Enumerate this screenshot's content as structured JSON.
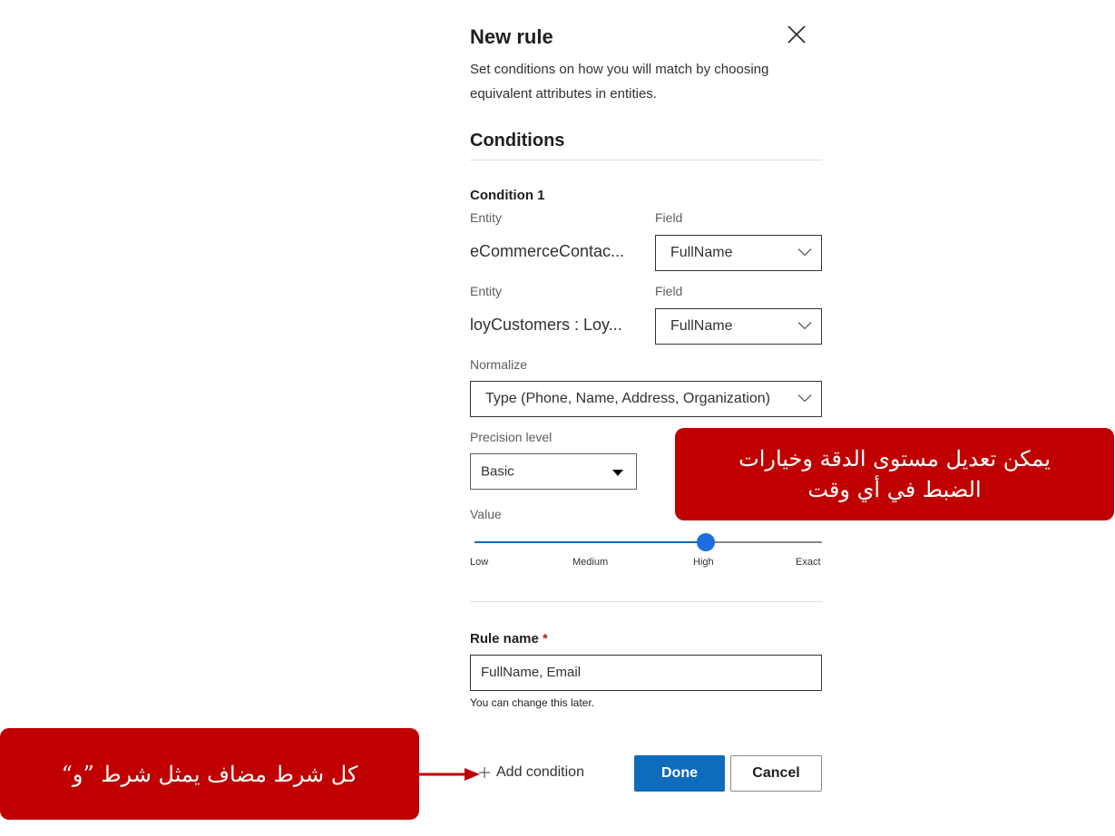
{
  "panel": {
    "title": "New rule",
    "description": "Set conditions on how you will match by choosing equivalent attributes in entities.",
    "conditions_heading": "Conditions"
  },
  "condition": {
    "title": "Condition 1",
    "row1": {
      "entity_label": "Entity",
      "field_label": "Field",
      "entity_value": "eCommerceContac...",
      "field_value": "FullName"
    },
    "row2": {
      "entity_label": "Entity",
      "field_label": "Field",
      "entity_value": "loyCustomers : Loy...",
      "field_value": "FullName"
    },
    "normalize_label": "Normalize",
    "normalize_value": "Type (Phone, Name, Address, Organization)",
    "precision_label": "Precision level",
    "precision_value": "Basic",
    "value_label": "Value",
    "slider": {
      "ticks": [
        "Low",
        "Medium",
        "High",
        "Exact"
      ],
      "selected": "High",
      "level": 0.667
    }
  },
  "rule_name": {
    "label": "Rule name",
    "required_mark": "*",
    "value": "FullName, Email",
    "hint": "You can change this later."
  },
  "actions": {
    "add_condition": "Add condition",
    "done": "Done",
    "cancel": "Cancel"
  },
  "callouts": {
    "precision_note": "يمكن تعديل مستوى الدقة وخيارات الضبط في أي وقت",
    "and_note": "كل شرط مضاف يمثل شرط ”و“"
  },
  "colors": {
    "accent": "#0f6cbd",
    "callout": "#c00000"
  }
}
